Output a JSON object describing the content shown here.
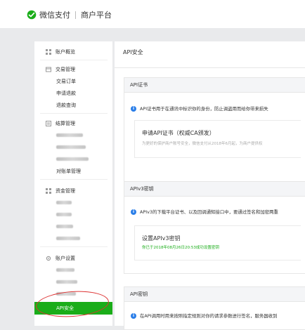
{
  "header": {
    "brand": "微信支付",
    "subtitle": "商户平台"
  },
  "sidebar": {
    "overview": "账户概览",
    "trade": {
      "title": "交易管理",
      "items": [
        "交易订单",
        "申请退款",
        "退款查询"
      ]
    },
    "settle": {
      "title": "结算管理",
      "last": "对账单管理"
    },
    "funds": {
      "title": "资金管理"
    },
    "account": {
      "title": "账户设置"
    },
    "active": "API安全"
  },
  "main": {
    "title": "API安全",
    "cert": {
      "header": "API证书",
      "info": "API证书用于在通讯中标识你的身份，防止调盗用而给你带来损失",
      "apply_title": "申请API证书（权威CA颁发）",
      "apply_desc": "为更好的保护商户账号安全，微信支付从2018年6月起，为商户提供权"
    },
    "v3": {
      "header": "APIv3密钥",
      "info": "APIv3的下载平台证书、以及回调通知接口中，要通过签名和加密两重",
      "set_title": "设置APIv3密钥",
      "set_desc": "你已于2018年08月26日20:53成功设置密钥"
    },
    "key": {
      "header": "API密钥",
      "info": "在API调用时用来按照指定规则对你的请求参数进行签名，服务器收到"
    }
  },
  "colors": {
    "accent": "#1aad19",
    "info": "#2a7ee8",
    "highlight": "#dd3333"
  }
}
